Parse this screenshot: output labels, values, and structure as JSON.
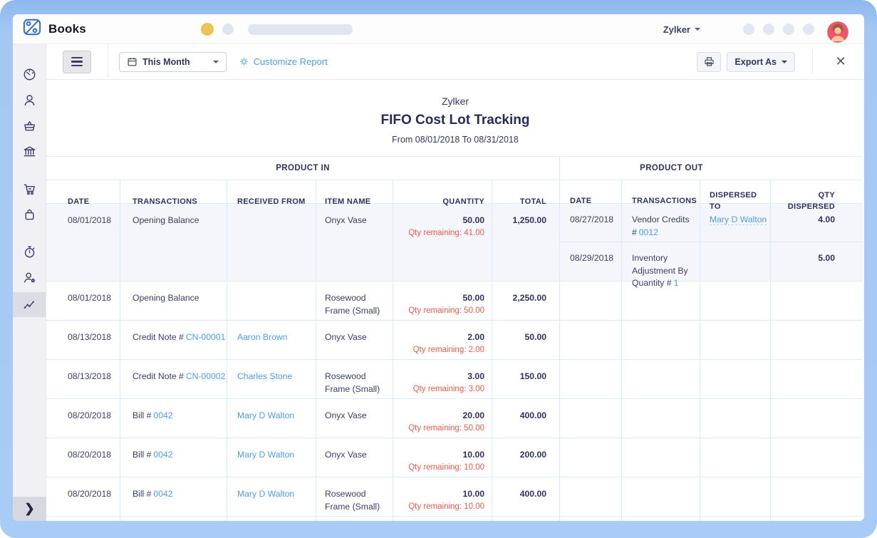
{
  "brand": {
    "name": "Books"
  },
  "topbar": {
    "account": "Zylker",
    "avatar": "user-avatar",
    "icon_placeholders": [
      "topbar-icon-1",
      "topbar-icon-2",
      "topbar-icon-3",
      "topbar-icon-4"
    ]
  },
  "toolbar": {
    "menu_icon": "hamburger",
    "calendar_icon": "calendar",
    "period": "This Month",
    "gear_icon": "gear",
    "customize": "Customize Report",
    "print_icon": "printer",
    "export": "Export As",
    "close_icon": "close"
  },
  "report": {
    "company": "Zylker",
    "title": "FIFO Cost Lot Tracking",
    "date_range": "From 08/01/2018 To 08/31/2018"
  },
  "table": {
    "group_in": "PRODUCT IN",
    "group_out": "PRODUCT OUT",
    "headers_in": [
      "DATE",
      "TRANSACTIONS",
      "RECEIVED FROM",
      "ITEM NAME",
      "QUANTITY",
      "TOTAL"
    ],
    "headers_out": [
      "DATE",
      "TRANSACTIONS",
      "DISPERSED TO",
      "QTY DISPERSED"
    ],
    "rows": [
      {
        "in": {
          "date": "08/01/2018",
          "txn": "Opening Balance",
          "txn_link": "",
          "received": "",
          "item": "Onyx Vase",
          "qty": "50.00",
          "remaining": "Qty remaining: 41.00",
          "total": "1,250.00"
        },
        "out": [
          {
            "date": "08/27/2018",
            "txn": "Vendor Credits #",
            "txn_link": "0012",
            "dispersed": "Mary D Walton",
            "qty": "4.00"
          },
          {
            "date": "08/29/2018",
            "txn": "Inventory Adjustment By Quantity #",
            "txn_link": "1",
            "dispersed": "",
            "qty": "5.00"
          }
        ]
      },
      {
        "in": {
          "date": "08/01/2018",
          "txn": "Opening Balance",
          "txn_link": "",
          "received": "",
          "item": "Rosewood Frame (Small)",
          "qty": "50.00",
          "remaining": "Qty remaining: 50.00",
          "total": "2,250.00"
        }
      },
      {
        "in": {
          "date": "08/13/2018",
          "txn": "Credit Note #",
          "txn_link": "CN-00001",
          "received": "Aaron Brown",
          "item": "Onyx Vase",
          "qty": "2.00",
          "remaining": "Qty remaining: 2.00",
          "total": "50.00"
        }
      },
      {
        "in": {
          "date": "08/13/2018",
          "txn": "Credit Note #",
          "txn_link": "CN-00002",
          "received": "Charles Stone",
          "item": "Rosewood Frame (Small)",
          "qty": "3.00",
          "remaining": "Qty remaining: 3.00",
          "total": "150.00"
        }
      },
      {
        "in": {
          "date": "08/20/2018",
          "txn": "Bill #",
          "txn_link": "0042",
          "received": "Mary D Walton",
          "item": "Onyx Vase",
          "qty": "20.00",
          "remaining": "Qty remaining: 50.00",
          "total": "400.00"
        }
      },
      {
        "in": {
          "date": "08/20/2018",
          "txn": "Bill #",
          "txn_link": "0042",
          "received": "Mary D Walton",
          "item": "Onyx Vase",
          "qty": "10.00",
          "remaining": "Qty remaining: 10.00",
          "total": "200.00"
        }
      },
      {
        "in": {
          "date": "08/20/2018",
          "txn": "Bill #",
          "txn_link": "0042",
          "received": "Mary D Walton",
          "item": "Rosewood Frame (Small)",
          "qty": "10.00",
          "remaining": "Qty remaining: 10.00",
          "total": "400.00"
        }
      }
    ]
  },
  "sidebar": {
    "items": [
      "dashboard",
      "contacts",
      "items",
      "banking",
      "sales",
      "purchases",
      "time-tracking",
      "accountant",
      "reports"
    ],
    "active": "reports",
    "expand_icon": "chevron-right"
  },
  "colors": {
    "frame_blue": "#A9CCF6",
    "link_blue": "#4A9DED",
    "danger_red": "#F0594B",
    "text_navy": "#33365F",
    "table_border": "#DCEBF9",
    "row_highlight": "#F5F6FB"
  }
}
